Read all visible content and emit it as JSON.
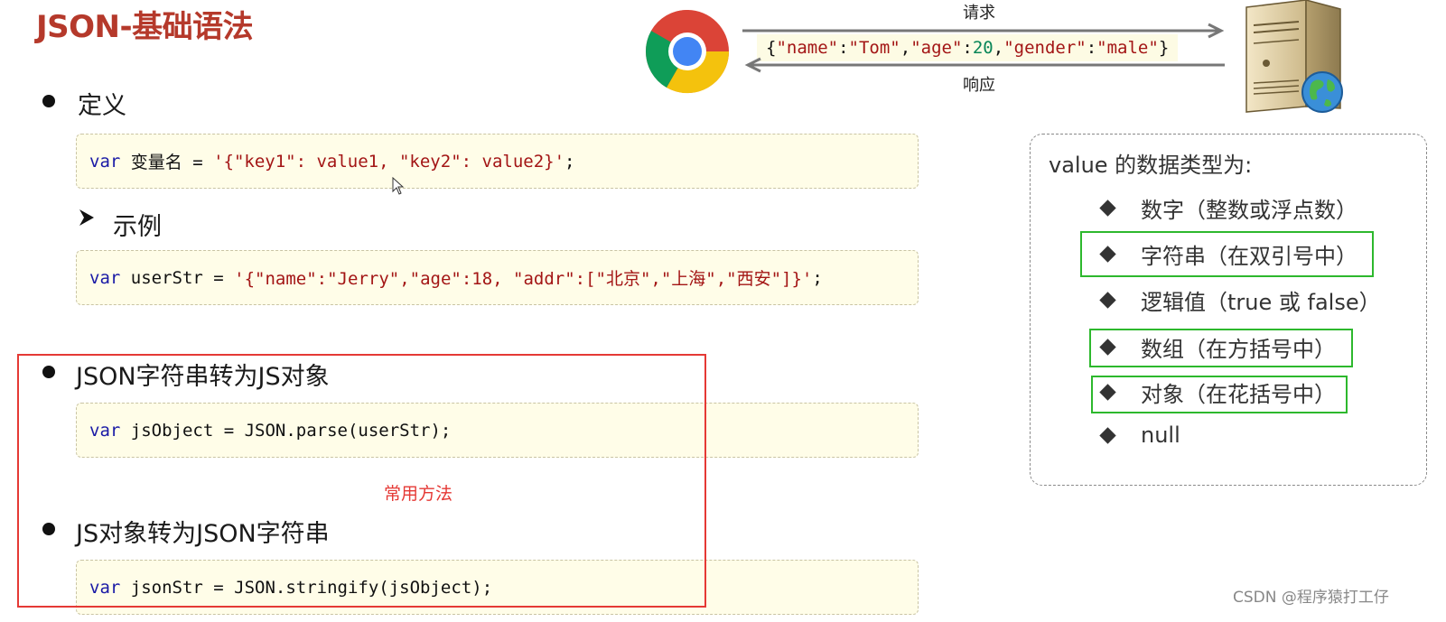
{
  "title": "JSON-基础语法",
  "sections": {
    "definition": {
      "heading": "定义",
      "code": {
        "kw": "var",
        "name": " 变量名 = ",
        "str": "'{\"key1\": value1, \"key2\": value2}'",
        "end": ";"
      }
    },
    "example": {
      "heading": "示例",
      "code": {
        "kw": "var",
        "name": " userStr = ",
        "str": "'{\"name\":\"Jerry\",\"age\":18, \"addr\":[\"北京\",\"上海\",\"西安\"]}'",
        "end": ";"
      }
    },
    "to_object": {
      "heading": "JSON字符串转为JS对象",
      "code": {
        "kw": "var",
        "rest": " jsObject = JSON.parse(userStr);"
      }
    },
    "common_note": "常用方法",
    "to_string": {
      "heading": "JS对象转为JSON字符串",
      "code": {
        "kw": "var",
        "rest": " jsonStr = JSON.stringify(jsObject);"
      }
    }
  },
  "diagram": {
    "request_label": "请求",
    "response_label": "响应",
    "json_sample": {
      "open": "{",
      "k1": "\"name\"",
      "c1": ":",
      "v1": "\"Tom\"",
      "s1": ",",
      "k2": "\"age\"",
      "c2": ":",
      "v2": "20",
      "s2": ",",
      "k3": "\"gender\"",
      "c3": ":",
      "v3": "\"male\"",
      "close": "}"
    },
    "browser_icon": "chrome-browser-icon",
    "server_icon": "web-server-icon"
  },
  "value_types": {
    "title": "value 的数据类型为:",
    "items": [
      {
        "label": "数字（整数或浮点数）",
        "highlighted": false
      },
      {
        "label": "字符串（在双引号中）",
        "highlighted": true
      },
      {
        "label": "逻辑值（true 或 false）",
        "highlighted": false
      },
      {
        "label": "数组（在方括号中）",
        "highlighted": true
      },
      {
        "label": "对象（在花括号中）",
        "highlighted": true
      },
      {
        "label": "null",
        "highlighted": false
      }
    ]
  },
  "watermark": "CSDN @程序猿打工仔",
  "colors": {
    "title": "#b5392b",
    "keyword": "#1a1aa6",
    "string": "#a31515",
    "number": "#098658",
    "red_frame": "#e53935",
    "green_frame": "#2db82d",
    "code_bg": "#fffde8"
  }
}
